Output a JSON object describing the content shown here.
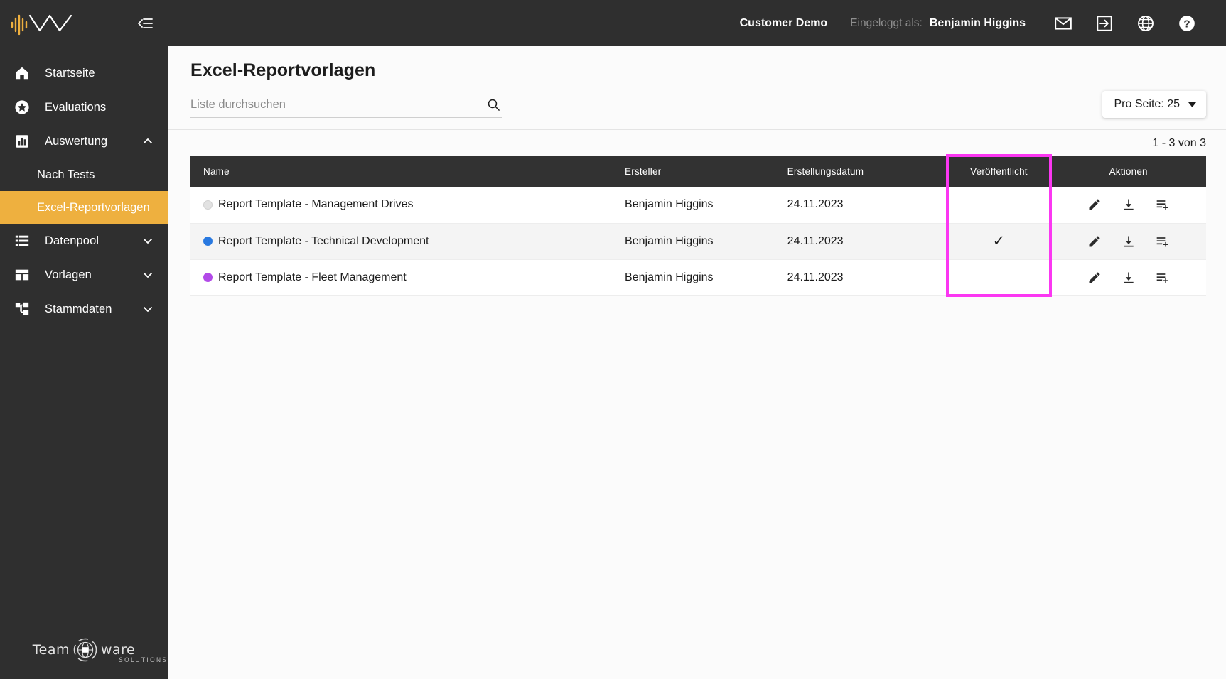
{
  "sidebar": {
    "logo_alt": "waveform-logo",
    "collapse_icon": "collapse-panel-icon",
    "items": [
      {
        "label": "Startseite",
        "icon": "home-icon",
        "expandable": false,
        "active": false
      },
      {
        "label": "Evaluations",
        "icon": "star-circle-icon",
        "expandable": false,
        "active": false
      },
      {
        "label": "Auswertung",
        "icon": "bar-chart-icon",
        "expandable": true,
        "expanded": true,
        "chevron": "chevron-up-icon",
        "active": false
      },
      {
        "label": "Datenpool",
        "icon": "list-icon",
        "expandable": true,
        "expanded": false,
        "chevron": "chevron-down-icon",
        "active": false
      },
      {
        "label": "Vorlagen",
        "icon": "layout-icon",
        "expandable": true,
        "expanded": false,
        "chevron": "chevron-down-icon",
        "active": false
      },
      {
        "label": "Stammdaten",
        "icon": "sitemap-icon",
        "expandable": true,
        "expanded": false,
        "chevron": "chevron-down-icon",
        "active": false
      }
    ],
    "subitems": [
      {
        "label": "Nach Tests",
        "active": false
      },
      {
        "label": "Excel-Reportvorlagen",
        "active": true
      }
    ],
    "footer_logo": {
      "word_left": "Team",
      "word_right": "ware",
      "subtitle": "SOLUTIONS"
    },
    "active_color": "#eeb03f",
    "background": "#2f2f2f"
  },
  "topbar": {
    "tenant": "Customer Demo",
    "logged_in_label": "Eingeloggt als:",
    "user": "Benjamin Higgins",
    "icons": [
      {
        "name": "mail-icon"
      },
      {
        "name": "logout-icon"
      },
      {
        "name": "globe-language-icon"
      },
      {
        "name": "help-icon"
      }
    ]
  },
  "page": {
    "title": "Excel-Reportvorlagen",
    "search": {
      "placeholder": "Liste durchsuchen",
      "value": "",
      "icon": "search-icon"
    },
    "per_page": {
      "label": "Pro Seite: 25",
      "chevron": "caret-down-icon"
    },
    "result_count": "1 - 3 von 3"
  },
  "table": {
    "columns": [
      "Name",
      "Ersteller",
      "Erstellungsdatum",
      "Veröffentlicht",
      "Aktionen"
    ],
    "rows": [
      {
        "dot_color": "#e2e2e2",
        "name": "Report Template - Management Drives",
        "creator": "Benjamin Higgins",
        "created": "24.11.2023",
        "published": false,
        "published_mark": ""
      },
      {
        "dot_color": "#2979e0",
        "name": "Report Template - Technical Development",
        "creator": "Benjamin Higgins",
        "created": "24.11.2023",
        "published": true,
        "published_mark": "✓"
      },
      {
        "dot_color": "#b24ae8",
        "name": "Report Template - Fleet Management",
        "creator": "Benjamin Higgins",
        "created": "24.11.2023",
        "published": false,
        "published_mark": ""
      }
    ],
    "row_actions": [
      {
        "name": "edit-icon"
      },
      {
        "name": "download-icon"
      },
      {
        "name": "add-to-list-icon"
      }
    ],
    "header_background": "#323232"
  },
  "annotation": {
    "highlight_color": "#fb37f2",
    "target_column": "Veröffentlicht"
  }
}
